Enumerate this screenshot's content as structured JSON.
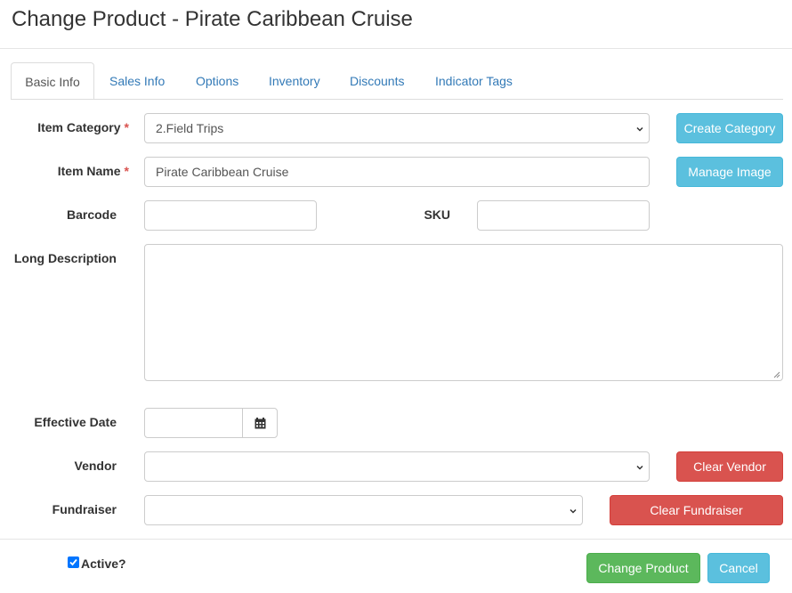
{
  "modal": {
    "title": "Change Product - Pirate Caribbean Cruise"
  },
  "tabs": [
    {
      "label": "Basic Info",
      "active": true
    },
    {
      "label": "Sales Info",
      "active": false
    },
    {
      "label": "Options",
      "active": false
    },
    {
      "label": "Inventory",
      "active": false
    },
    {
      "label": "Discounts",
      "active": false
    },
    {
      "label": "Indicator Tags",
      "active": false
    }
  ],
  "form": {
    "item_category": {
      "label": "Item Category",
      "required_mark": "*",
      "value": "2.Field Trips"
    },
    "item_name": {
      "label": "Item Name",
      "required_mark": "*",
      "value": "Pirate Caribbean Cruise"
    },
    "barcode": {
      "label": "Barcode",
      "value": ""
    },
    "sku": {
      "label": "SKU",
      "value": ""
    },
    "long_description": {
      "label": "Long Description",
      "value": ""
    },
    "effective_date": {
      "label": "Effective Date",
      "value": ""
    },
    "vendor": {
      "label": "Vendor",
      "value": ""
    },
    "fundraiser": {
      "label": "Fundraiser",
      "value": ""
    },
    "active": {
      "label": "Active?",
      "checked": true
    }
  },
  "buttons": {
    "create_category": "Create Category",
    "manage_image": "Manage Image",
    "clear_vendor": "Clear Vendor",
    "clear_fundraiser": "Clear Fundraiser",
    "change_product": "Change Product",
    "cancel": "Cancel"
  },
  "icons": {
    "date_picker": "calendar-icon",
    "select": "chevron-down-icon",
    "resize": "resize-grip-icon",
    "checkbox": "checkmark-icon"
  },
  "colors": {
    "primary_link": "#337ab7",
    "info": "#5bc0de",
    "danger": "#d9534f",
    "success": "#5cb85c",
    "required": "#d9534f",
    "checkbox": "#0075ff"
  }
}
